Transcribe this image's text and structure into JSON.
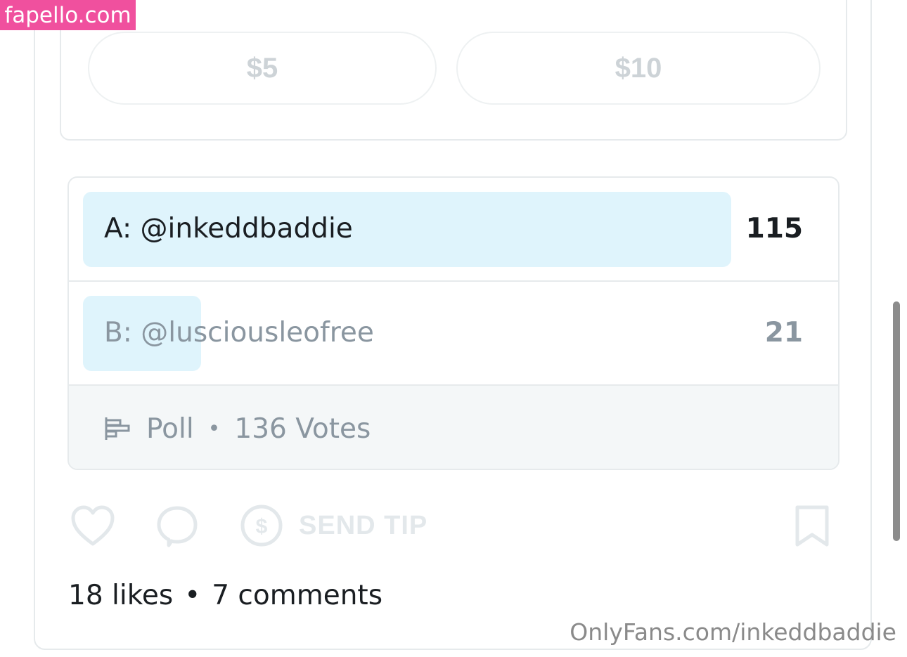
{
  "watermarks": {
    "site": "fapello.com",
    "source": "OnlyFans.com/inkeddbaddie"
  },
  "tip_amounts": [
    "$5",
    "$10"
  ],
  "poll": {
    "options": [
      {
        "label": "A: @inkeddbaddie",
        "count": "115",
        "votes": 115
      },
      {
        "label": "B: @lusciousleofree",
        "count": "21",
        "votes": 21
      }
    ],
    "footer": {
      "type_label": "Poll",
      "votes_label": "136 Votes",
      "icon": "poll-icon"
    }
  },
  "actions": {
    "like_icon": "heart-icon",
    "comment_icon": "comment-icon",
    "tip_icon": "dollar-circle-icon",
    "send_tip_label": "SEND TIP",
    "bookmark_icon": "bookmark-icon"
  },
  "stats": {
    "likes": "18 likes",
    "comments": "7 comments"
  },
  "colors": {
    "bar_fill": "#dff4fc",
    "border": "#e6eaec",
    "muted_text": "#8a96a0",
    "winner_text": "#1a1e22",
    "watermark_bg": "#f0509e"
  }
}
